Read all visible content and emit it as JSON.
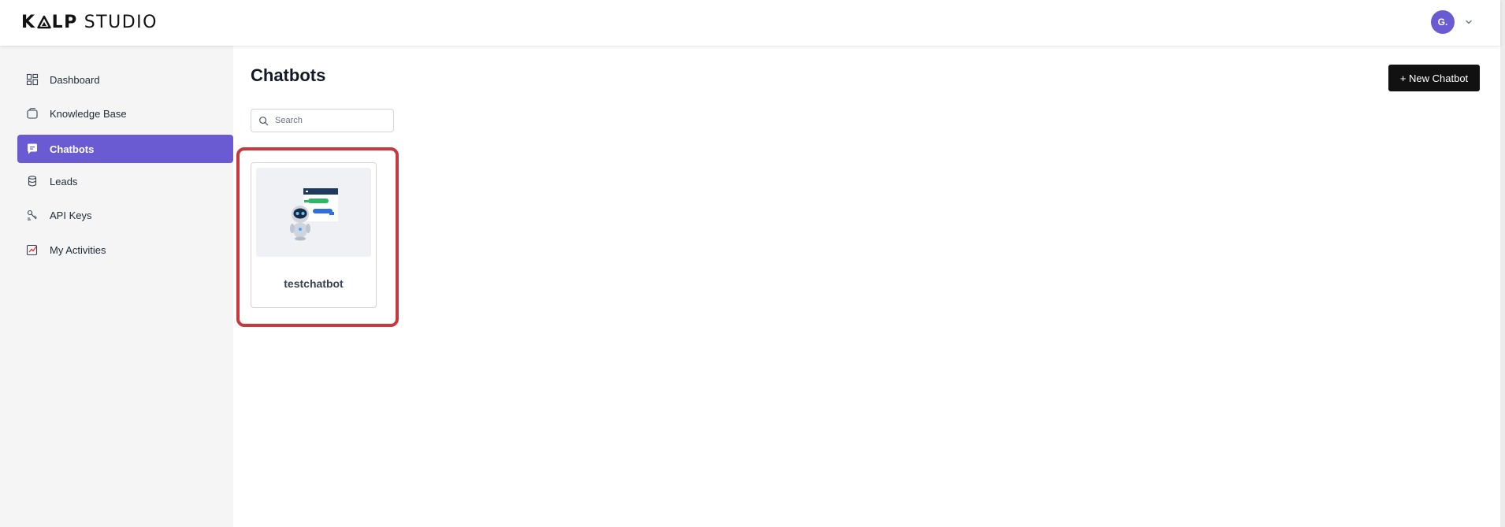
{
  "header": {
    "logo_bold_left": "K",
    "logo_bold_right": "LP",
    "logo_light": "STUDIO",
    "avatar_initials": "G.",
    "avatar_color": "#6b5bd2"
  },
  "sidebar": {
    "items": [
      {
        "label": "Dashboard",
        "icon": "dashboard-icon"
      },
      {
        "label": "Knowledge Base",
        "icon": "knowledge-base-icon"
      },
      {
        "label": "Chatbots",
        "icon": "chatbot-icon",
        "active": true
      },
      {
        "label": "Leads",
        "icon": "database-icon"
      },
      {
        "label": "API Keys",
        "icon": "api-keys-icon"
      },
      {
        "label": "My Activities",
        "icon": "activity-chart-icon"
      }
    ],
    "active_color": "#6b5bd2"
  },
  "main": {
    "title": "Chatbots",
    "new_button_label": "+ New Chatbot",
    "search_placeholder": "Search",
    "search_value": "",
    "chatbots": [
      {
        "name": "testchatbot",
        "thumbnail": "robot-chat-illustration"
      }
    ],
    "highlight_color": "#c8383d"
  }
}
